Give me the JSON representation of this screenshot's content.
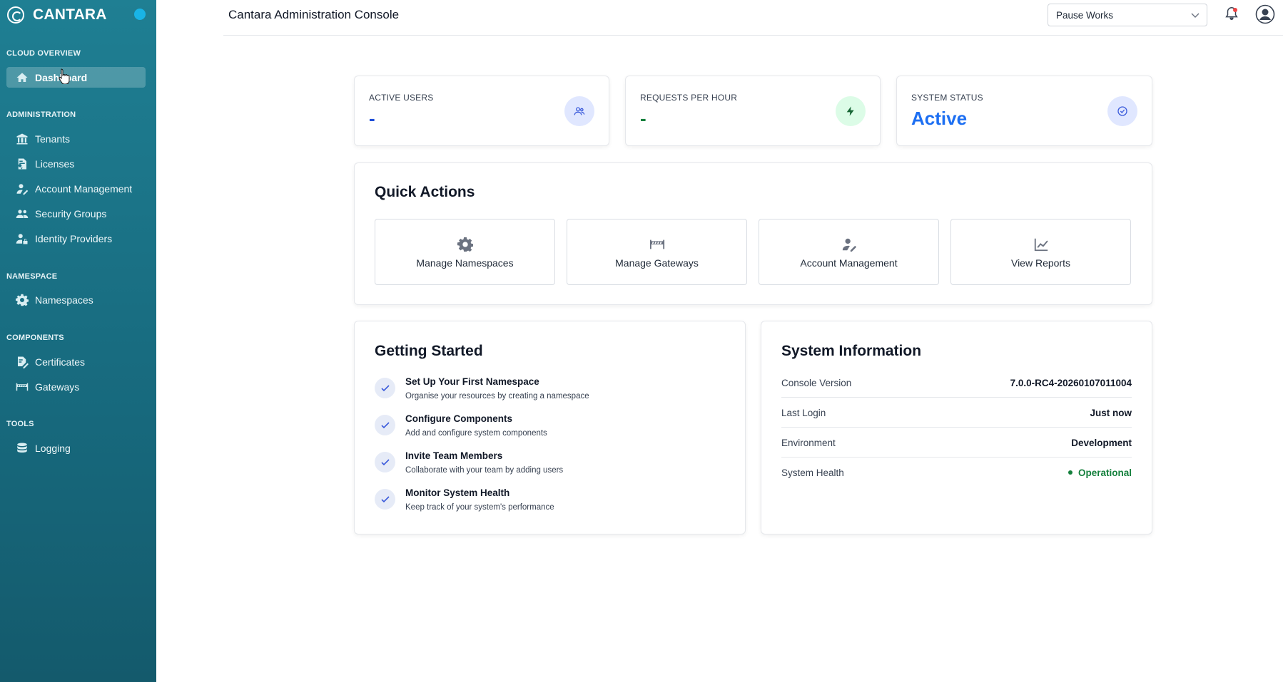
{
  "sidebar": {
    "brand": "CANTARA",
    "sections": [
      {
        "label": "CLOUD OVERVIEW",
        "items": [
          {
            "label": "Dashboard",
            "icon": "home-icon",
            "active": true
          }
        ]
      },
      {
        "label": "ADMINISTRATION",
        "items": [
          {
            "label": "Tenants",
            "icon": "building-icon"
          },
          {
            "label": "Licenses",
            "icon": "license-icon"
          },
          {
            "label": "Account Management",
            "icon": "user-edit-icon"
          },
          {
            "label": "Security Groups",
            "icon": "users-icon"
          },
          {
            "label": "Identity Providers",
            "icon": "user-lock-icon"
          }
        ]
      },
      {
        "label": "NAMESPACE",
        "items": [
          {
            "label": "Namespaces",
            "icon": "gear-icon"
          }
        ]
      },
      {
        "label": "COMPONENTS",
        "items": [
          {
            "label": "Certificates",
            "icon": "certificate-icon"
          },
          {
            "label": "Gateways",
            "icon": "gateway-icon"
          }
        ]
      },
      {
        "label": "TOOLS",
        "items": [
          {
            "label": "Logging",
            "icon": "database-icon"
          }
        ]
      }
    ]
  },
  "header": {
    "title": "Cantara Administration Console",
    "tenant_select": "Pause Works"
  },
  "stats": [
    {
      "label": "ACTIVE USERS",
      "value": "-",
      "value_color": "#1d4ed8",
      "icon": "users-icon",
      "icon_bg": "#e0e7ff",
      "icon_color": "#3b5bdb"
    },
    {
      "label": "REQUESTS PER HOUR",
      "value": "-",
      "value_color": "#15803d",
      "icon": "bolt-icon",
      "icon_bg": "#dcfce7",
      "icon_color": "#166534"
    },
    {
      "label": "SYSTEM STATUS",
      "value": "Active",
      "value_color": "#1d6ff2",
      "icon": "check-circle-icon",
      "icon_bg": "#e0e7ff",
      "icon_color": "#3b5bdb"
    }
  ],
  "quick_actions": {
    "title": "Quick Actions",
    "items": [
      {
        "label": "Manage Namespaces",
        "icon": "gear-icon"
      },
      {
        "label": "Manage Gateways",
        "icon": "gateway-icon"
      },
      {
        "label": "Account Management",
        "icon": "user-edit-icon"
      },
      {
        "label": "View Reports",
        "icon": "chart-line-icon"
      }
    ]
  },
  "getting_started": {
    "title": "Getting Started",
    "items": [
      {
        "title": "Set Up Your First Namespace",
        "desc": "Organise your resources by creating a namespace"
      },
      {
        "title": "Configure Components",
        "desc": "Add and configure system components"
      },
      {
        "title": "Invite Team Members",
        "desc": "Collaborate with your team by adding users"
      },
      {
        "title": "Monitor System Health",
        "desc": "Keep track of your system's performance"
      }
    ]
  },
  "system_info": {
    "title": "System Information",
    "rows": [
      {
        "label": "Console Version",
        "value": "7.0.0-RC4-20260107011004"
      },
      {
        "label": "Last Login",
        "value": "Just now"
      },
      {
        "label": "Environment",
        "value": "Development"
      },
      {
        "label": "System Health",
        "value": "Operational",
        "status": "ok"
      }
    ]
  }
}
